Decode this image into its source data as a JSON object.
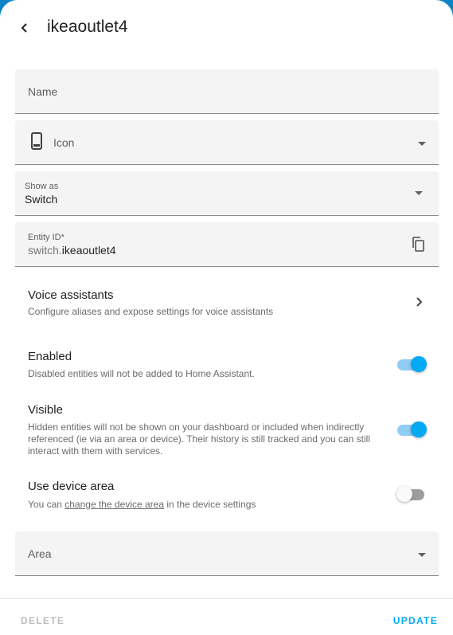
{
  "header": {
    "title": "ikeaoutlet4",
    "back_icon": "chevron-left-icon"
  },
  "name_field": {
    "label": "Name",
    "value": ""
  },
  "icon_field": {
    "label": "Icon",
    "icon": "cellphone-icon"
  },
  "show_as_field": {
    "label": "Show as",
    "value": "Switch"
  },
  "entity_id_field": {
    "label": "Entity ID*",
    "prefix": "switch.",
    "value": "ikeaoutlet4",
    "copy_icon": "content-copy-icon"
  },
  "voice_assistants": {
    "title": "Voice assistants",
    "description": "Configure aliases and expose settings for voice assistants"
  },
  "enabled": {
    "title": "Enabled",
    "description": "Disabled entities will not be added to Home Assistant.",
    "state": "on"
  },
  "visible": {
    "title": "Visible",
    "description": "Hidden entities will not be shown on your dashboard or included when indirectly referenced (ie via an area or device). Their history is still tracked and you can still interact with them with services.",
    "state": "on"
  },
  "use_device_area": {
    "title": "Use device area",
    "description_prefix": "You can ",
    "link_text": "change the device area",
    "description_suffix": " in the device settings",
    "state": "off"
  },
  "area_field": {
    "label": "Area"
  },
  "footer": {
    "delete_label": "DELETE",
    "update_label": "UPDATE"
  },
  "colors": {
    "accent": "#03a9f4",
    "backdrop": "#0d84c8",
    "field_bg": "#f4f4f4",
    "disabled_text": "#bdbdbd"
  }
}
